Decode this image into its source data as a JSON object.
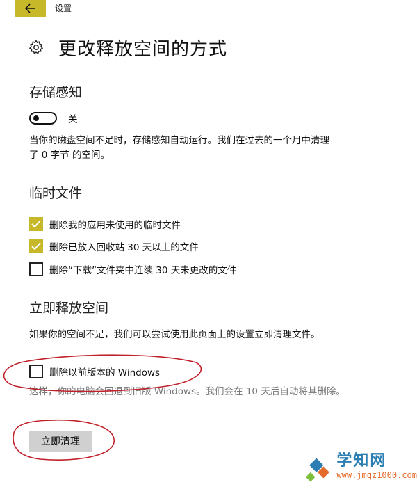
{
  "window": {
    "app_title": "设置"
  },
  "header": {
    "title": "更改释放空间的方式"
  },
  "storage_sense": {
    "heading": "存储感知",
    "toggle_state": "关",
    "toggle_on": false,
    "description": "当你的磁盘空间不足时，存储感知自动运行。我们在过去的一个月中清理了 0 字节 的空间。"
  },
  "temp_files": {
    "heading": "临时文件",
    "options": [
      {
        "label": "删除我的应用未使用的临时文件",
        "checked": true
      },
      {
        "label": "删除已放入回收站 30 天以上的文件",
        "checked": true
      },
      {
        "label": "删除“下载”文件夹中连续 30 天未更改的文件",
        "checked": false
      }
    ]
  },
  "free_up_now": {
    "heading": "立即释放空间",
    "description": "如果你的空间不足，我们可以尝试使用此页面上的设置立即清理文件。",
    "option": {
      "label": "删除以前版本的 Windows",
      "checked": false
    },
    "note": "这样，你的电脑会回退到旧版 Windows。我们会在 10 天后自动将其删除。",
    "button_label": "立即清理"
  },
  "watermark": {
    "name": "学知网",
    "url": "www.jmqz1000.com"
  },
  "colors": {
    "accent": "#c6b828",
    "annotation": "#c0202a",
    "logo_blue": "#2d7fb3",
    "logo_orange": "#e46a2a"
  },
  "icons": {
    "back": "arrow-left-icon",
    "settings": "gear-icon",
    "check": "checkmark-icon"
  }
}
